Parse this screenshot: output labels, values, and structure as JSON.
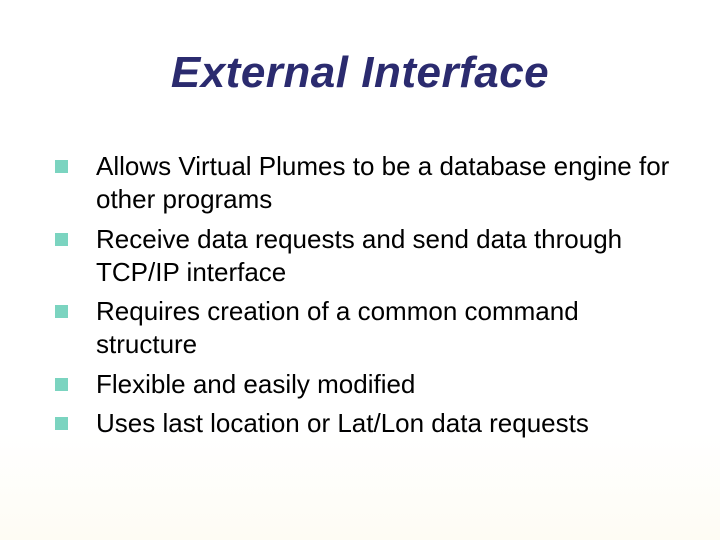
{
  "title": "External Interface",
  "bullets": [
    "Allows Virtual Plumes to be a database engine for other programs",
    "Receive data requests and send data through TCP/IP interface",
    "Requires creation of a common command structure",
    "Flexible and easily modified",
    "Uses last location or Lat/Lon data requests"
  ]
}
